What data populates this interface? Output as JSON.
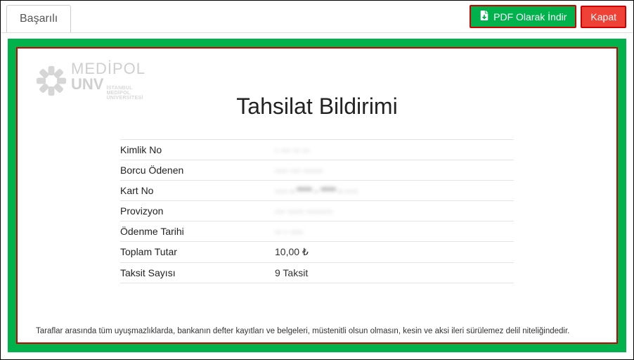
{
  "header": {
    "tab_label": "Başarılı",
    "pdf_button": "PDF Olarak İndir",
    "close_button": "Kapat"
  },
  "logo": {
    "line1": "MEDİPOL",
    "line2": "UNV",
    "sub1": "İSTANBUL",
    "sub2": "MEDİPOL",
    "sub3": "ÜNİVERSİTESİ"
  },
  "title": "Tahsilat Bildirimi",
  "details": [
    {
      "label": "Kimlik No",
      "value": "·  ··· ··  ··",
      "clear": false
    },
    {
      "label": "Borcu Ödenen",
      "value": "····  ··· ······",
      "clear": false
    },
    {
      "label": "Kart No",
      "value": "···· - **** - **** - ····",
      "clear": false
    },
    {
      "label": "Provizyon",
      "value": "···  ·····  ········",
      "clear": false
    },
    {
      "label": "Ödenme Tarihi",
      "value": "·· · ····",
      "clear": false
    },
    {
      "label": "Toplam Tutar",
      "value": "10,00 ₺",
      "clear": true
    },
    {
      "label": "Taksit Sayısı",
      "value": "9 Taksit",
      "clear": true
    }
  ],
  "footer_note": "Taraflar arasında tüm uyuşmazlıklarda, bankanın defter kayıtları ve belgeleri, müstenitli olsun olmasın, kesin ve aksi ileri sürülemez delil niteliğindedir."
}
